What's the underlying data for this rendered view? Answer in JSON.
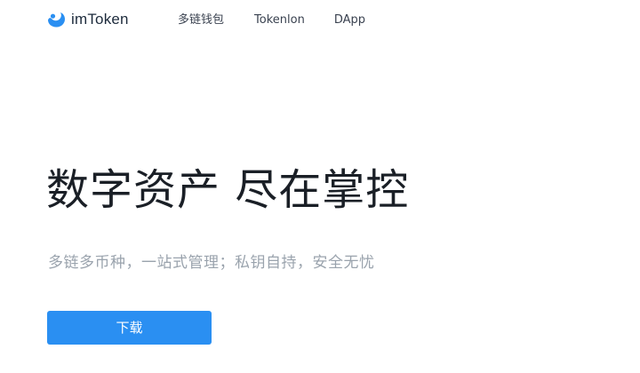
{
  "nav": {
    "brand": {
      "name": "imToken",
      "icon": "imtoken-logo-icon",
      "color": "#2a8ff2"
    },
    "links": [
      {
        "label": "多链钱包"
      },
      {
        "label": "Tokenlon"
      },
      {
        "label": "DApp"
      }
    ]
  },
  "hero": {
    "title": "数字资产 尽在掌控",
    "subtitle": "多链多币种，一站式管理；私钥自持，安全无忧",
    "download_label": "下载",
    "button_color": "#2a8ff2"
  }
}
